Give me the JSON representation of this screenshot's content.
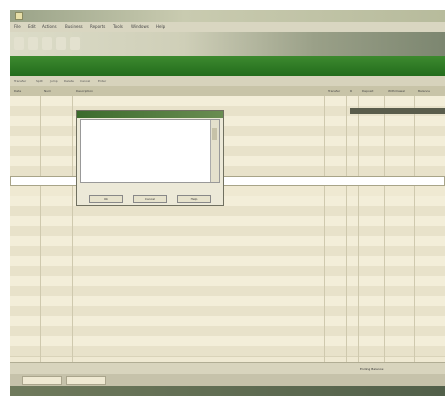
{
  "window": {
    "title": ""
  },
  "menu": {
    "items": [
      "File",
      "Edit",
      "Actions",
      "Business",
      "Reports",
      "Tools",
      "Windows",
      "Help"
    ]
  },
  "toolbar": {
    "buttons": [
      "",
      "",
      "",
      "",
      ""
    ]
  },
  "register": {
    "title": "",
    "info_items": [
      "Transfer",
      "Split",
      "Jump",
      "Delete",
      "Cancel",
      "Enter"
    ],
    "columns": [
      "Date",
      "Num",
      "Description",
      "Transfer",
      "R",
      "Deposit",
      "Withdrawal",
      "Balance"
    ],
    "rows": [
      {
        "date": "",
        "num": "",
        "description": "",
        "transfer": "",
        "amount": "",
        "balance": ""
      },
      {
        "date": "",
        "num": "",
        "description": "",
        "transfer": "",
        "amount": "",
        "balance": ""
      },
      {
        "date": "",
        "num": "",
        "description": "",
        "transfer": "",
        "amount": "",
        "balance": ""
      },
      {
        "date": "",
        "num": "",
        "description": "",
        "transfer": "",
        "amount": "",
        "balance": ""
      },
      {
        "date": "",
        "num": "",
        "description": "",
        "transfer": "",
        "amount": "",
        "balance": ""
      },
      {
        "date": "",
        "num": "",
        "description": "",
        "transfer": "",
        "amount": "",
        "balance": ""
      },
      {
        "date": "",
        "num": "",
        "description": "",
        "transfer": "",
        "amount": "",
        "balance": ""
      },
      {
        "date": "",
        "num": "",
        "description": "",
        "transfer": "",
        "amount": "",
        "balance": ""
      }
    ],
    "selected_row": {
      "date": "",
      "num": "",
      "description": "",
      "amount": ""
    }
  },
  "popup": {
    "title": "",
    "list": [
      "",
      "",
      "",
      "",
      "",
      "",
      ""
    ],
    "right_values": [
      "",
      "",
      "",
      ""
    ],
    "filter_label": "",
    "buttons": [
      "Ok",
      "Cancel",
      "Help"
    ]
  },
  "status": {
    "ending_balance_label": "Ending Balance:",
    "ending_balance_value": ""
  },
  "tabs": [
    "",
    ""
  ],
  "bottom": {
    "items": [
      "",
      "",
      ""
    ]
  }
}
